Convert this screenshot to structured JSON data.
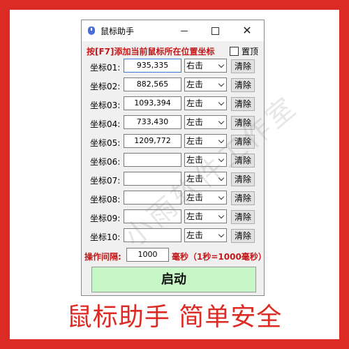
{
  "window": {
    "title": "鼠标助手"
  },
  "hint": "按[F7]添加当前鼠标所在位置坐标",
  "topmost_label": "置顶",
  "rows": [
    {
      "label": "坐标01:",
      "coord": "935,335",
      "click": "右击",
      "clear": "清除"
    },
    {
      "label": "坐标02:",
      "coord": "882,565",
      "click": "左击",
      "clear": "清除"
    },
    {
      "label": "坐标03:",
      "coord": "1093,394",
      "click": "左击",
      "clear": "清除"
    },
    {
      "label": "坐标04:",
      "coord": "733,430",
      "click": "左击",
      "clear": "清除"
    },
    {
      "label": "坐标05:",
      "coord": "1209,772",
      "click": "左击",
      "clear": "清除"
    },
    {
      "label": "坐标06:",
      "coord": "",
      "click": "左击",
      "clear": "清除"
    },
    {
      "label": "坐标07:",
      "coord": "",
      "click": "左击",
      "clear": "清除"
    },
    {
      "label": "坐标08:",
      "coord": "",
      "click": "左击",
      "clear": "清除"
    },
    {
      "label": "坐标09:",
      "coord": "",
      "click": "左击",
      "clear": "清除"
    },
    {
      "label": "坐标10:",
      "coord": "",
      "click": "左击",
      "clear": "清除"
    }
  ],
  "interval": {
    "label": "操作间隔:",
    "value": "1000",
    "unit": "毫秒（1秒=1000毫秒）"
  },
  "start_label": "启动",
  "footer": "鼠标助手 简单安全",
  "watermark": "小雨软件工作室",
  "colors": {
    "frame": "#dc2b24",
    "start_button": "#c7f7c7",
    "hint_text": "#c21a1a"
  }
}
